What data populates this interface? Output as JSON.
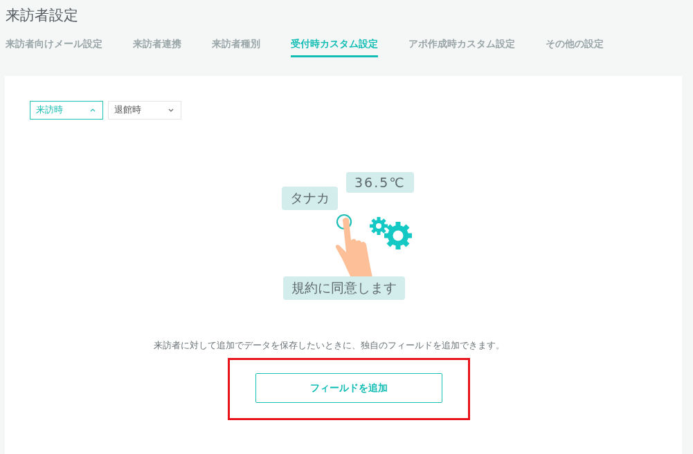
{
  "page": {
    "title": "来訪者設定"
  },
  "tabs": [
    {
      "label": "来訪者向けメール設定",
      "selected": false
    },
    {
      "label": "来訪者連携",
      "selected": false
    },
    {
      "label": "来訪者種別",
      "selected": false
    },
    {
      "label": "受付時カスタム設定",
      "selected": true
    },
    {
      "label": "アポ作成時カスタム設定",
      "selected": false
    },
    {
      "label": "その他の設定",
      "selected": false
    }
  ],
  "dropdowns": [
    {
      "value": "来訪時",
      "expanded": true
    },
    {
      "value": "退館時",
      "expanded": false
    }
  ],
  "illustration": {
    "bubbles": [
      "タナカ",
      "36.5℃",
      "規約に同意します"
    ]
  },
  "description": "来訪者に対して追加でデータを保存したいときに、独自のフィールドを追加できます。",
  "add_button": {
    "label": "フィールドを追加",
    "highlighted": true
  }
}
